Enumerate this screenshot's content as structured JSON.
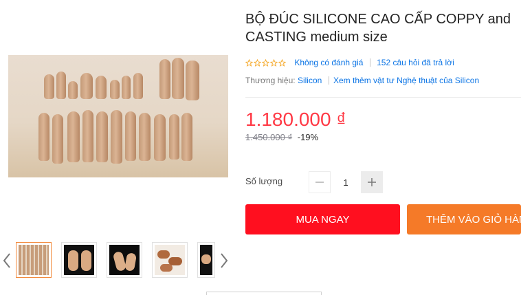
{
  "product": {
    "title": "BỘ ĐÚC SILICONE CAO CẤP COPPY and CASTING medium size",
    "rating_text": "Không có đánh giá",
    "questions_text": "152 câu hỏi đã trả lời",
    "brand_label": "Thương hiệu:",
    "brand_name": "Silicon",
    "brand_more_link": "Xem thêm vật tư Nghệ thuật của Silicon",
    "price": "1.180.000 ₫",
    "list_price": "1.450.000 ₫",
    "discount": "-19%"
  },
  "quantity": {
    "label": "Số lượng",
    "value": "1"
  },
  "actions": {
    "buy_now": "MUA NGAY",
    "add_to_cart": "THÊM VÀO GIỎ HÀNG"
  },
  "gallery": {
    "thumbnails": [
      {
        "name": "silicone-fingers-thumbnail",
        "active": true
      },
      {
        "name": "hands-pair-thumbnail",
        "active": false
      },
      {
        "name": "hands-pose-thumbnail",
        "active": false
      },
      {
        "name": "cast-pieces-thumbnail",
        "active": false
      },
      {
        "name": "hand-partial-thumbnail",
        "active": false
      }
    ]
  },
  "colors": {
    "price": "#ff3945",
    "buy_button": "#ff0f1f",
    "cart_button": "#f57a28",
    "link": "#0b74e5",
    "active_thumb_border": "#f28a3c"
  },
  "icons": [
    "star-outline-icon",
    "minus-icon",
    "plus-icon",
    "chevron-left-icon",
    "chevron-right-icon"
  ]
}
